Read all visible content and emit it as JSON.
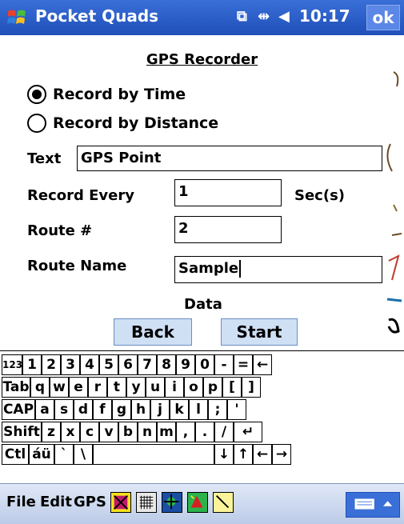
{
  "titlebar": {
    "title": "Pocket Quads",
    "time": "10:17",
    "ok_label": "ok"
  },
  "form": {
    "heading": "GPS Recorder",
    "radio_time": "Record by Time",
    "radio_distance": "Record by Distance",
    "selected": "time",
    "text_label": "Text",
    "text_value": "GPS Point",
    "record_every_label": "Record Every",
    "record_every_value": "1",
    "record_every_unit": "Sec(s)",
    "route_label": "Route #",
    "route_value": "2",
    "route_name_label": "Route Name",
    "route_name_value": "Sample",
    "data_label": "Data",
    "back_label": "Back",
    "start_label": "Start"
  },
  "keyboard": {
    "row1": [
      "123",
      "1",
      "2",
      "3",
      "4",
      "5",
      "6",
      "7",
      "8",
      "9",
      "0",
      "-",
      "=",
      "←"
    ],
    "row2": [
      "Tab",
      "q",
      "w",
      "e",
      "r",
      "t",
      "y",
      "u",
      "i",
      "o",
      "p",
      "[",
      "]"
    ],
    "row3": [
      "CAP",
      "a",
      "s",
      "d",
      "f",
      "g",
      "h",
      "j",
      "k",
      "l",
      ";",
      "'"
    ],
    "row4": [
      "Shift",
      "z",
      "x",
      "c",
      "v",
      "b",
      "n",
      "m",
      ",",
      ".",
      "/",
      "↵"
    ],
    "row5": [
      "Ctl",
      "áü",
      "`",
      "\\",
      "",
      "↓",
      "↑",
      "←",
      "→"
    ]
  },
  "menubar": {
    "file": "File",
    "edit": "Edit",
    "gps": "GPS"
  },
  "icons": {
    "windows_logo": "windows-logo-icon",
    "sync": "sync-icon",
    "connectivity": "connectivity-icon",
    "volume": "volume-icon",
    "keyboard": "keyboard-icon"
  }
}
